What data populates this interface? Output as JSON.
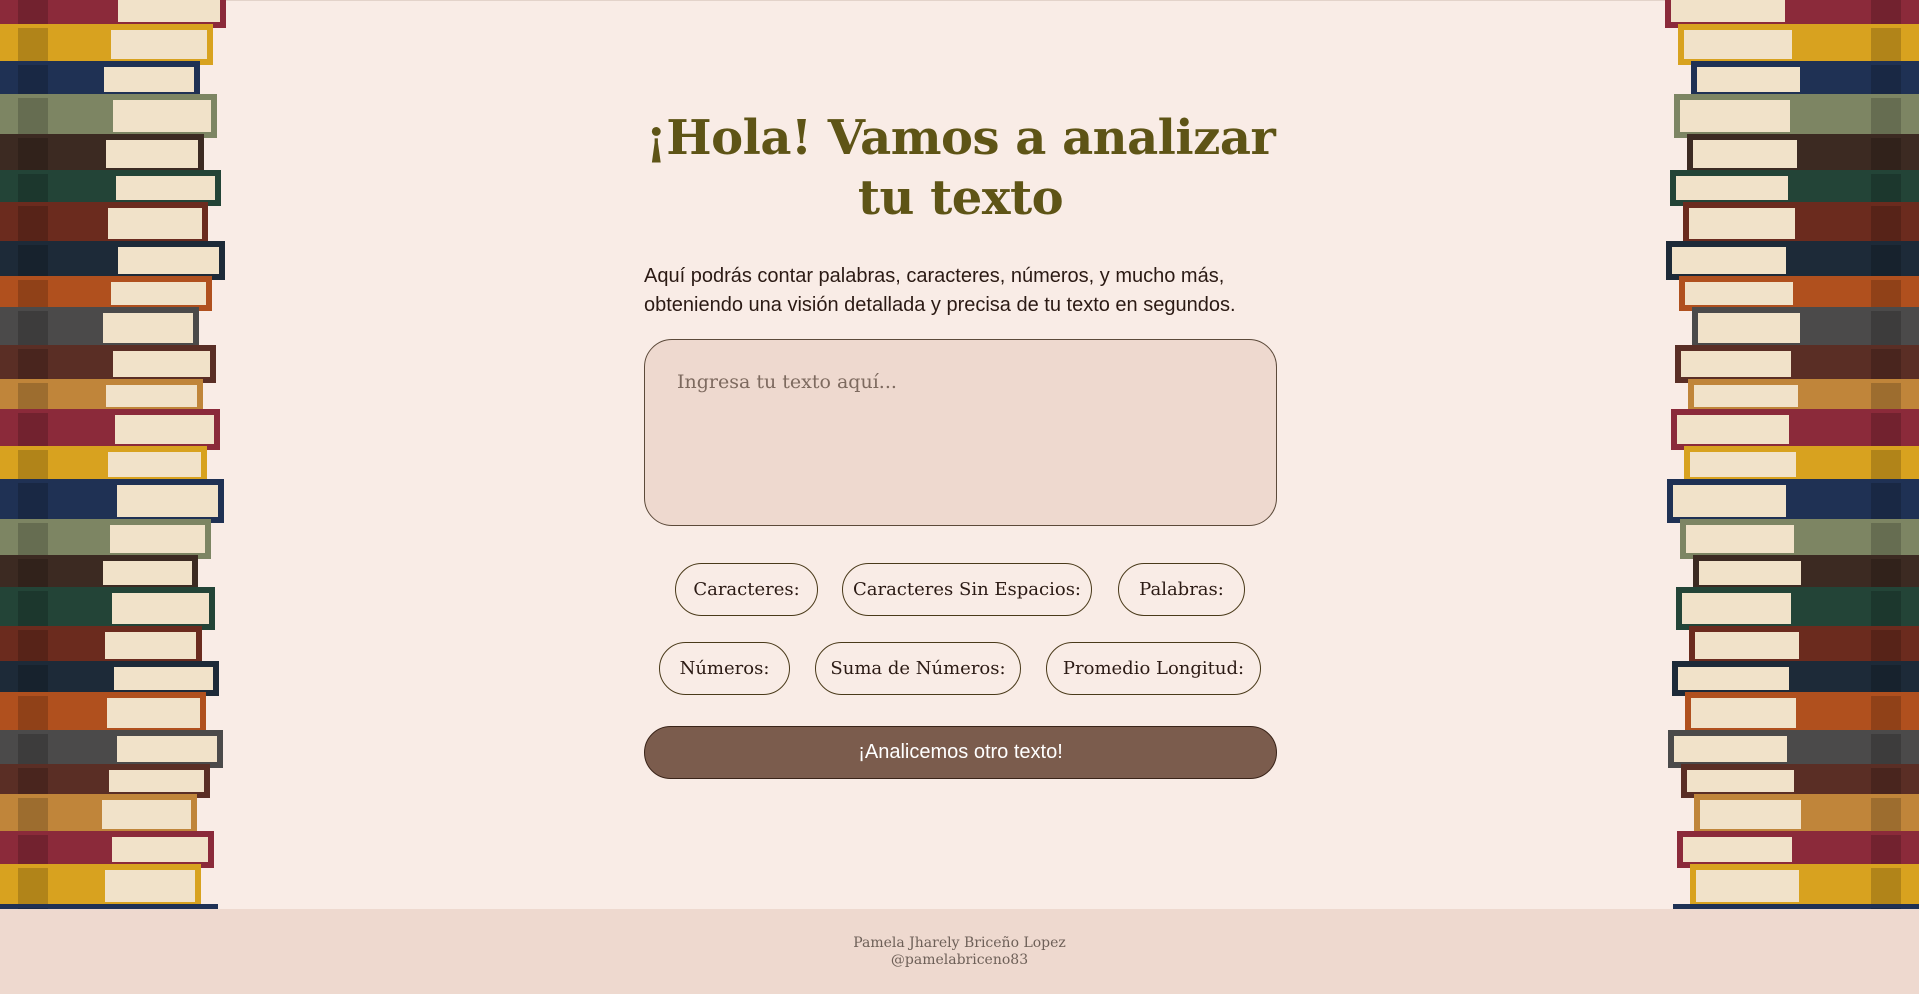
{
  "header": {
    "title": "¡Hola! Vamos a analizar tu texto",
    "subtitle": "Aquí podrás contar palabras, caracteres, números, y mucho más, obteniendo una visión detallada y precisa de tu texto en segundos."
  },
  "input": {
    "placeholder": "Ingresa tu texto aquí...",
    "value": ""
  },
  "stats": {
    "characters": "Caracteres:",
    "characters_no_spaces": "Caracteres Sin Espacios:",
    "words": "Palabras:",
    "numbers": "Números:",
    "numbers_sum": "Suma de Números:",
    "average_length": "Promedio Longitud:"
  },
  "actions": {
    "reset_label": "¡Analicemos otro texto!"
  },
  "footer": {
    "author": "Pamela Jharely Briceño Lopez",
    "handle": "@pamelabriceno83"
  },
  "colors": {
    "background": "#f9ece6",
    "title": "#5e5416",
    "panel": "#eed9cf",
    "button": "#7b5c4d"
  },
  "decorations": {
    "left": "book-stack-image",
    "right": "book-stack-image"
  }
}
